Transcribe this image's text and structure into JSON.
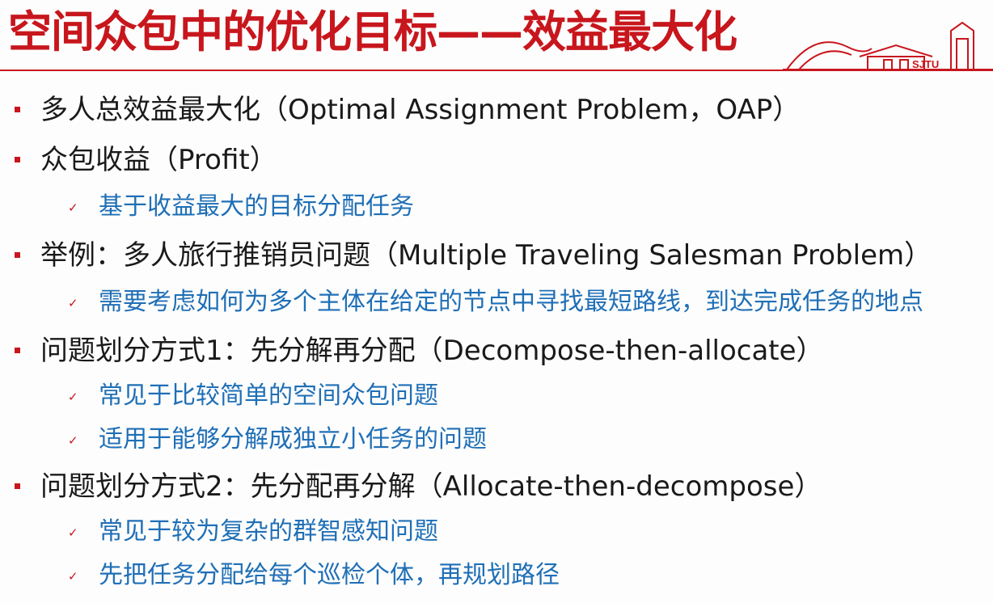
{
  "colors": {
    "accent_red": "#c8161d",
    "sub_blue": "#1f6fb6",
    "body_text": "#1a1a1a"
  },
  "slide": {
    "title": "空间众包中的优化目标——效益最大化",
    "logo_text": "SJTU",
    "bullets": [
      {
        "text": "多人总效益最大化（Optimal Assignment Problem，OAP）",
        "subs": []
      },
      {
        "text": "众包收益（Profit）",
        "subs": [
          "基于收益最大的目标分配任务"
        ]
      },
      {
        "text": "举例：多人旅行推销员问题（Multiple Traveling Salesman Problem）",
        "subs": [
          "需要考虑如何为多个主体在给定的节点中寻找最短路线，到达完成任务的地点"
        ]
      },
      {
        "text": "问题划分方式1：先分解再分配（Decompose-then-allocate）",
        "subs": [
          "常见于比较简单的空间众包问题",
          "适用于能够分解成独立小任务的问题"
        ]
      },
      {
        "text": "问题划分方式2：先分配再分解（Allocate-then-decompose）",
        "subs": [
          "常见于较为复杂的群智感知问题",
          "先把任务分配给每个巡检个体，再规划路径"
        ]
      }
    ],
    "check_glyph": "✓"
  }
}
